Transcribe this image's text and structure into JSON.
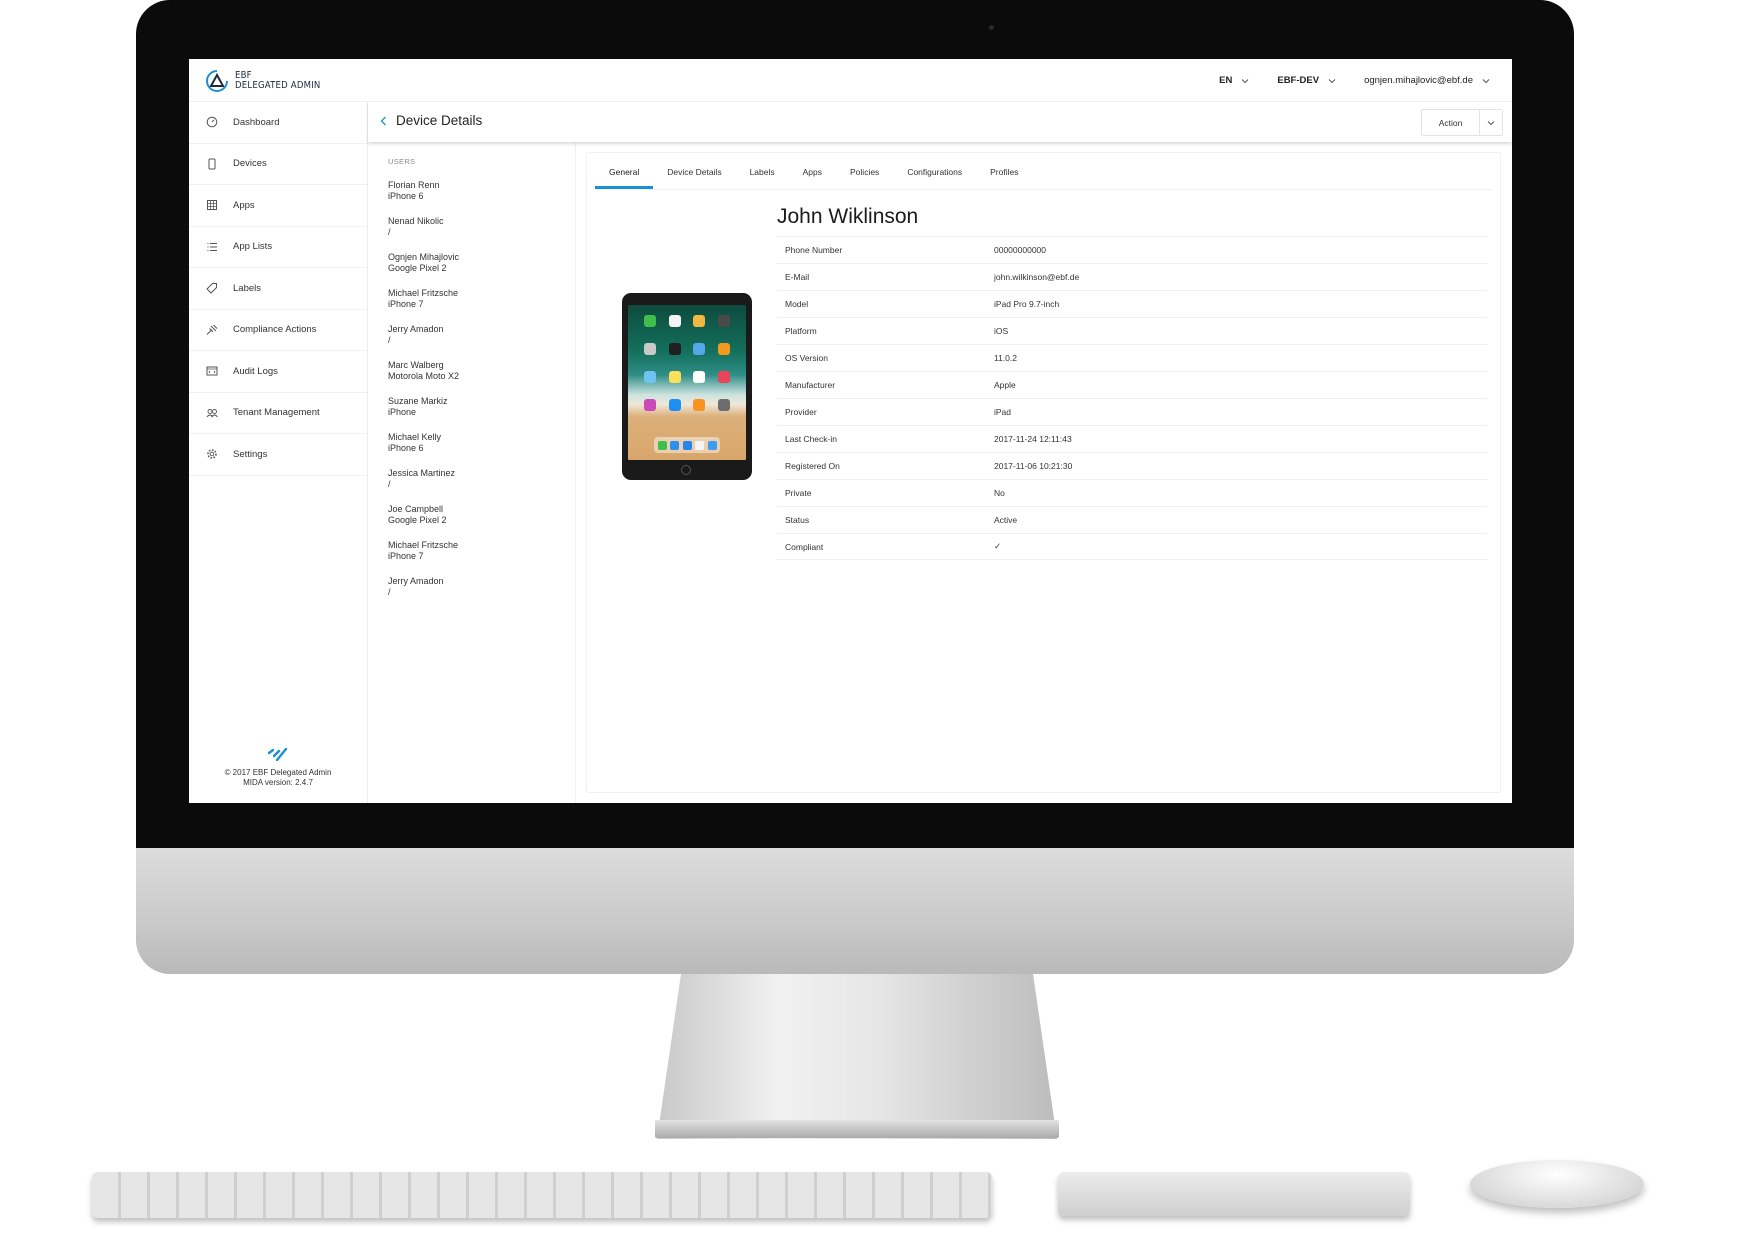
{
  "app": {
    "logo_line1": "EBF",
    "logo_line2": "DELEGATED ADMIN",
    "accent_color": "#1d8fd6"
  },
  "topbar": {
    "language": "EN",
    "tenant": "EBF-DEV",
    "user_email": "ognjen.mihajlovic@ebf.de"
  },
  "sidebar": {
    "items": [
      {
        "label": "Dashboard",
        "icon": "dashboard-icon"
      },
      {
        "label": "Devices",
        "icon": "device-icon"
      },
      {
        "label": "Apps",
        "icon": "grid-icon"
      },
      {
        "label": "App Lists",
        "icon": "list-icon"
      },
      {
        "label": "Labels",
        "icon": "tag-icon"
      },
      {
        "label": "Compliance Actions",
        "icon": "gavel-icon"
      },
      {
        "label": "Audit Logs",
        "icon": "code-window-icon"
      },
      {
        "label": "Tenant Management",
        "icon": "users-icon"
      },
      {
        "label": "Settings",
        "icon": "gear-icon"
      }
    ],
    "footer_copyright": "© 2017 EBF Delegated Admin",
    "footer_version": "MIDA version: 2.4.7"
  },
  "header": {
    "title": "Device Details",
    "action_label": "Action"
  },
  "users": {
    "heading": "USERS",
    "items": [
      {
        "name": "Florian Renn",
        "device": "iPhone 6"
      },
      {
        "name": "Nenad Nikolic",
        "device": "/"
      },
      {
        "name": "Ognjen Mihajlovic",
        "device": "Google Pixel 2"
      },
      {
        "name": "Michael Fritzsche",
        "device": "iPhone 7"
      },
      {
        "name": "Jerry Amadon",
        "device": "/"
      },
      {
        "name": "Marc Walberg",
        "device": "Motorola Moto X2"
      },
      {
        "name": "Suzane Markiz",
        "device": "iPhone"
      },
      {
        "name": "Michael Kelly",
        "device": "iPhone 6"
      },
      {
        "name": "Jessica Martinez",
        "device": "/"
      },
      {
        "name": "Joe Campbell",
        "device": "Google Pixel 2"
      },
      {
        "name": "Michael Fritzsche",
        "device": "iPhone 7"
      },
      {
        "name": "Jerry Amadon",
        "device": "/"
      }
    ]
  },
  "tabs": [
    {
      "label": "General",
      "active": true
    },
    {
      "label": "Device Details",
      "active": false
    },
    {
      "label": "Labels",
      "active": false
    },
    {
      "label": "Apps",
      "active": false
    },
    {
      "label": "Policies",
      "active": false
    },
    {
      "label": "Configurations",
      "active": false
    },
    {
      "label": "Profiles",
      "active": false
    }
  ],
  "device": {
    "owner_name": "John Wiklinson",
    "properties": [
      {
        "label": "Phone Number",
        "value": "00000000000"
      },
      {
        "label": "E-Mail",
        "value": "john.wilkinson@ebf.de"
      },
      {
        "label": "Model",
        "value": "iPad Pro 9.7-inch"
      },
      {
        "label": "Platform",
        "value": "iOS"
      },
      {
        "label": "OS Version",
        "value": "11.0.2"
      },
      {
        "label": "Manufacturer",
        "value": "Apple"
      },
      {
        "label": "Provider",
        "value": "iPad"
      },
      {
        "label": "Last Check-in",
        "value": "2017-11-24 12:11:43"
      },
      {
        "label": "Registered On",
        "value": "2017-11-06 10:21:30"
      },
      {
        "label": "Private",
        "value": "No"
      },
      {
        "label": "Status",
        "value": "Active"
      },
      {
        "label": "Compliant",
        "value": "✓"
      }
    ]
  }
}
